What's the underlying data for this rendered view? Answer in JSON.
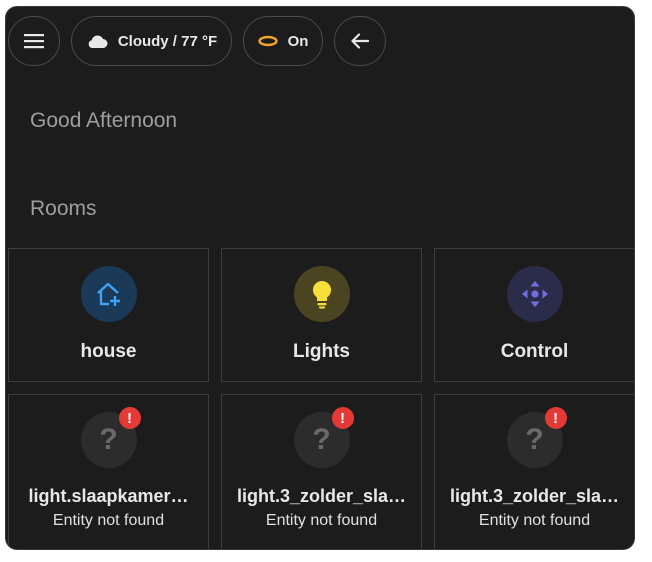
{
  "header": {
    "menu_icon": "hamburger-menu-icon",
    "weather": {
      "icon": "cloud-icon",
      "label": "Cloudy / 77 °F"
    },
    "light_chip": {
      "icon": "ceiling-light-icon",
      "label": "On",
      "icon_color": "#f5a623"
    },
    "back_icon": "arrow-left-icon"
  },
  "greeting": "Good Afternoon",
  "rooms_title": "Rooms",
  "rooms": [
    {
      "label": "house",
      "icon": "home-plus-icon",
      "icon_color": "#3fa2f6",
      "bg": "#1b3a57"
    },
    {
      "label": "Lights",
      "icon": "lightbulb-icon",
      "icon_color": "#f7df3b",
      "bg": "#4a4420"
    },
    {
      "label": "Control",
      "icon": "move-arrows-icon",
      "icon_color": "#6f6fe0",
      "bg": "#2b2b4a"
    }
  ],
  "entities": [
    {
      "label": "light.slaapkamer…",
      "status": "Entity not found"
    },
    {
      "label": "light.3_zolder_sla…",
      "status": "Entity not found"
    },
    {
      "label": "light.3_zolder_sla…",
      "status": "Entity not found"
    }
  ],
  "colors": {
    "panel_bg": "#1c1c1c",
    "error_badge": "#e53935"
  }
}
